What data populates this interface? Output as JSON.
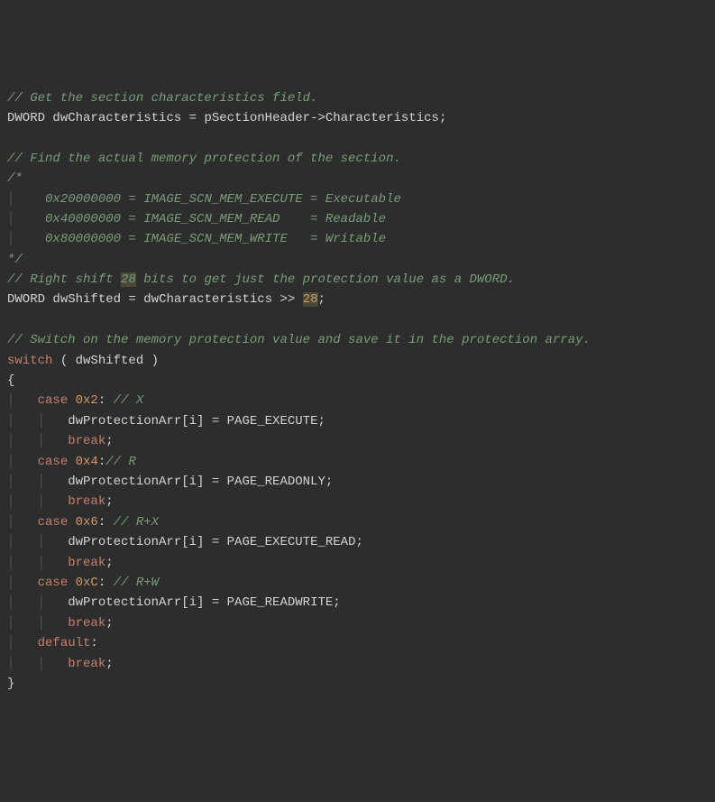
{
  "lines": {
    "l1": "// Get the section characteristics field.",
    "l2_type": "DWORD",
    "l2_var": "dwCharacteristics",
    "l2_eq": "=",
    "l2_ptr": "pSectionHeader",
    "l2_arrow": "->",
    "l2_member": "Characteristics",
    "l2_semi": ";",
    "l3": "// Find the actual memory protection of the section.",
    "l4": "/*",
    "l5": "    0x20000000 = IMAGE_SCN_MEM_EXECUTE = Executable",
    "l6": "    0x40000000 = IMAGE_SCN_MEM_READ    = Readable",
    "l7": "    0x80000000 = IMAGE_SCN_MEM_WRITE   = Writable",
    "l8": "*/",
    "l9_a": "// Right shift ",
    "l9_hl": "28",
    "l9_b": " bits to get just the protection value as a DWORD.",
    "l10_type": "DWORD",
    "l10_var": "dwShifted",
    "l10_eq": "=",
    "l10_rhs": "dwCharacteristics",
    "l10_shift": ">>",
    "l10_num": "28",
    "l10_semi": ";",
    "l11": "// Switch on the memory protection value and save it in the protection array.",
    "l12_switch": "switch",
    "l12_paren": " ( dwShifted )",
    "l13": "{",
    "case1_kw": "case",
    "case1_num": "0x2",
    "case1_colon": ":",
    "case1_comment": "// X",
    "case1_body": "dwProtectionArr[i] = PAGE_EXECUTE;",
    "case1_break": "break",
    "case1_semi": ";",
    "case2_kw": "case",
    "case2_num": "0x4",
    "case2_colon": ":",
    "case2_comment": "// R",
    "case2_body": "dwProtectionArr[i] = PAGE_READONLY;",
    "case2_break": "break",
    "case2_semi": ";",
    "case3_kw": "case",
    "case3_num": "0x6",
    "case3_colon": ":",
    "case3_comment": "// R+X",
    "case3_body": "dwProtectionArr[i] = PAGE_EXECUTE_READ;",
    "case3_break": "break",
    "case3_semi": ";",
    "case4_kw": "case",
    "case4_num": "0xC",
    "case4_colon": ":",
    "case4_comment": "// R+W",
    "case4_body": "dwProtectionArr[i] = PAGE_READWRITE;",
    "case4_break": "break",
    "case4_semi": ";",
    "default_kw": "default",
    "default_colon": ":",
    "default_break": "break",
    "default_semi": ";",
    "l_end": "}"
  }
}
